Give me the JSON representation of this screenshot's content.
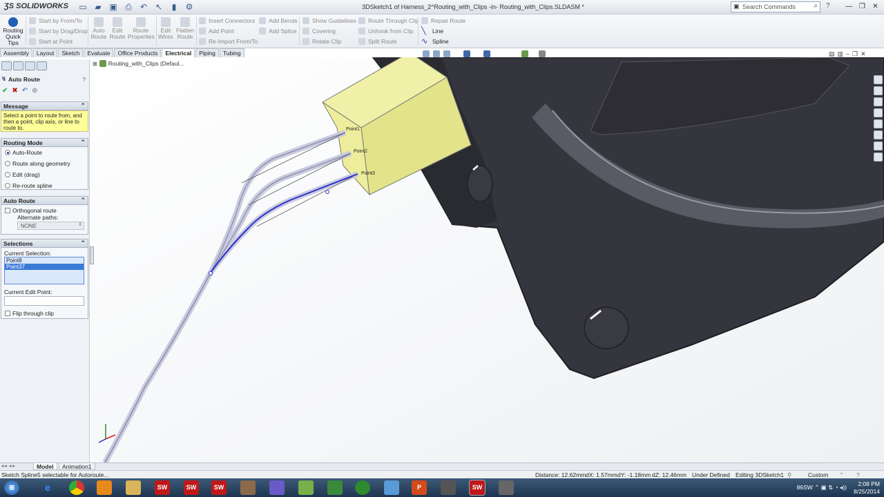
{
  "app": {
    "name": "SOLIDWORKS",
    "doc_title": "3DSketch1 of Harness_2^Routing_with_Clips -in- Routing_with_Clips.SLDASM *"
  },
  "search": {
    "placeholder": "Search Commands"
  },
  "ribbon": {
    "big_buttons": [
      "Routing Quick Tips",
      "Auto Route",
      "Edit Route",
      "Route Properties",
      "Edit Wires",
      "Flatten Route"
    ],
    "start_group": [
      "Start by From/To",
      "Start by Drag/Drop",
      "Start at Point"
    ],
    "connector_group": [
      "Insert Connectors",
      "Add Point",
      "Re-Import From/To"
    ],
    "bend_group": [
      "Add Bends",
      "Add Splice"
    ],
    "guide_group": [
      "Show Guidelines",
      "Covering",
      "Rotate Clip"
    ],
    "clip_group": [
      "Route Through Clip",
      "Unhook from Clip",
      "Split Route"
    ],
    "repair_group": [
      "Repair Route",
      "Line",
      "Spline"
    ]
  },
  "tabs": [
    "Assembly",
    "Layout",
    "Sketch",
    "Evaluate",
    "Office Products",
    "Electrical",
    "Piping",
    "Tubing"
  ],
  "active_tab": "Electrical",
  "tree": {
    "root": "Routing_with_Clips  (Defaul..."
  },
  "property_manager": {
    "title": "Auto Route",
    "help": "?",
    "message_header": "Message",
    "message": "Select a point to route from, and then a point, clip axis, or line to route to.",
    "routing_mode_header": "Routing Mode",
    "routing_modes": [
      "Auto-Route",
      "Route along geometry",
      "Edit (drag)",
      "Re-route spline"
    ],
    "selected_mode": "Auto-Route",
    "auto_route_header": "Auto Route",
    "orthogonal_label": "Orthogonal route",
    "alternate_paths_label": "Alternate paths:",
    "alternate_paths_value": "NONE",
    "selections_header": "Selections",
    "current_selection_label": "Current Selection:",
    "current_selection_items": [
      "Point8",
      "Point37"
    ],
    "current_edit_point_label": "Current Edit Point:",
    "flip_label": "Flip through clip"
  },
  "viewport": {
    "points": [
      "Point1",
      "Point2",
      "Point3"
    ],
    "connector_color": "#e6e88a",
    "part_color": "#35353d"
  },
  "bottom_tabs": [
    "Model",
    "Animation1"
  ],
  "status": {
    "hint": "Sketch Spline5 selectable for Autoroute...",
    "distance": "Distance: 12.62mm",
    "dx": "dX: 1.57mm",
    "dy": "dY: -1.18mm",
    "dz": "dZ: 12.46mm",
    "state": "Under Defined",
    "editing": "Editing 3DSketch1",
    "units": "Custom"
  },
  "taskbar": {
    "tray_text": "86SW",
    "time": "2:08 PM",
    "date": "8/25/2014"
  }
}
